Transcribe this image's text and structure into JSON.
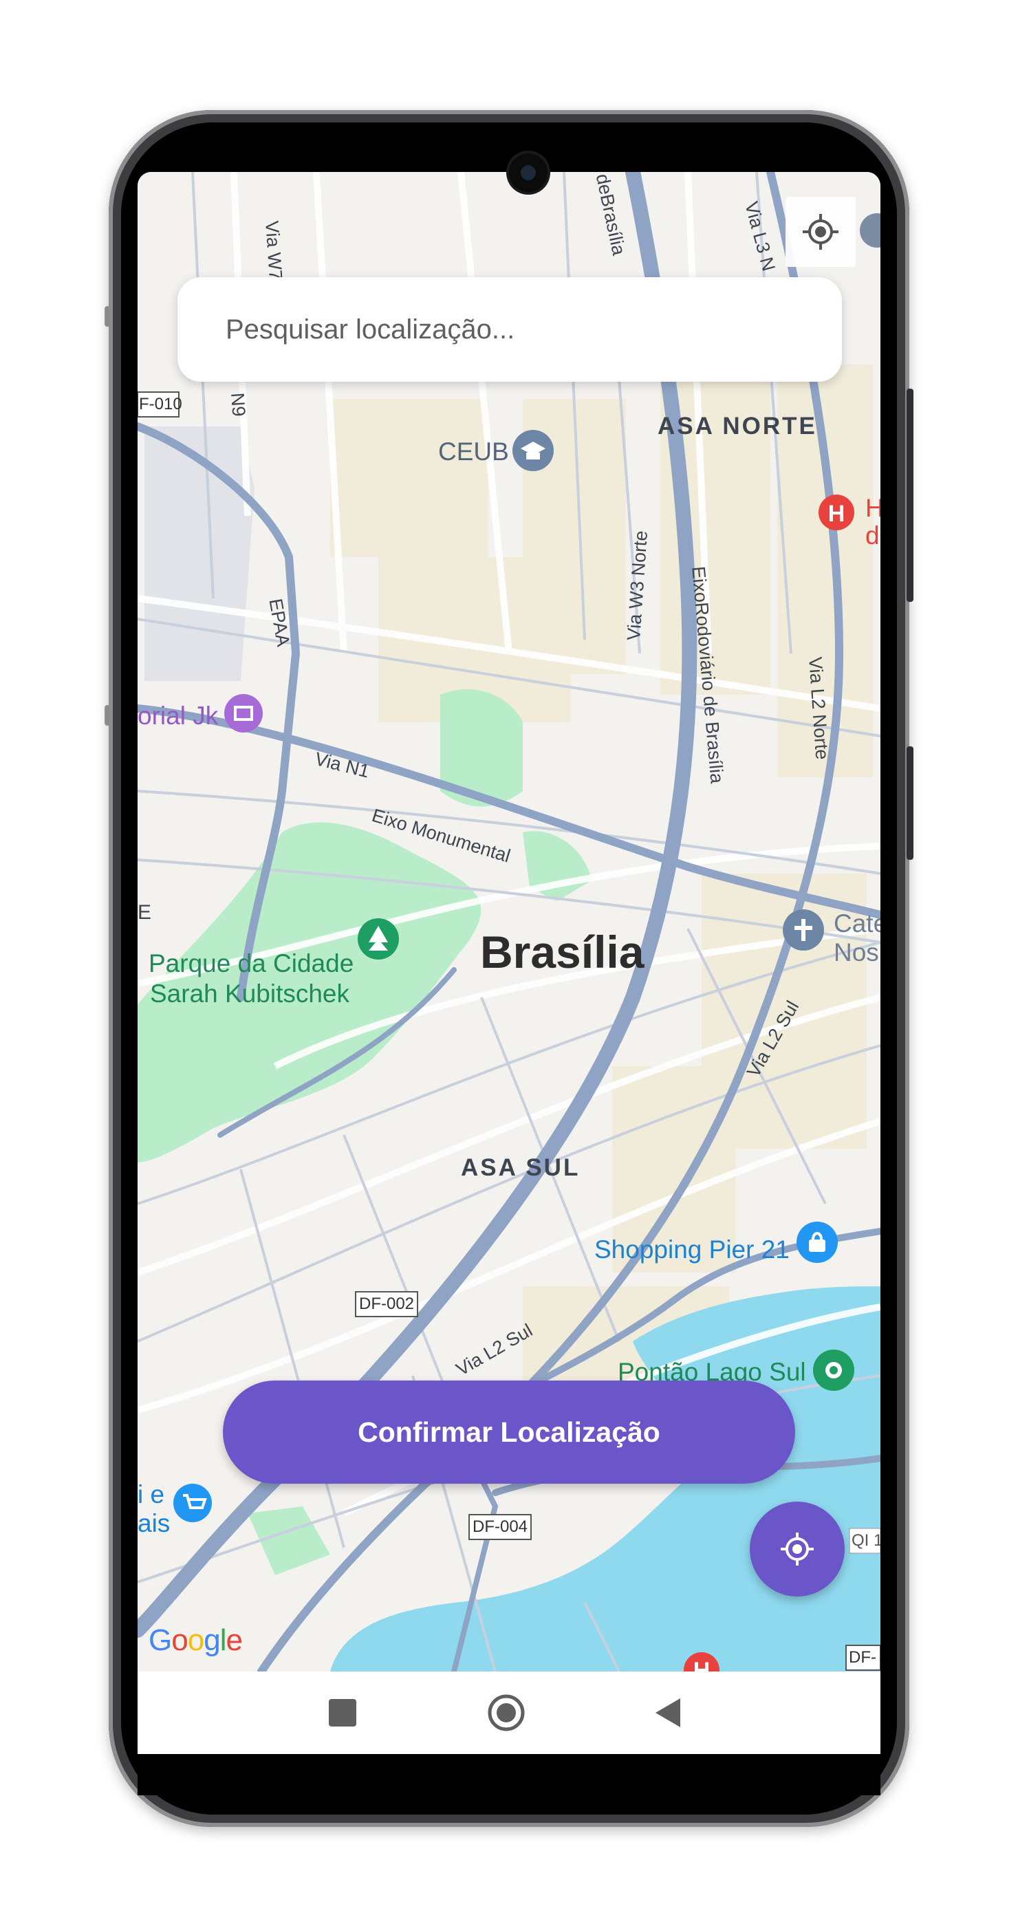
{
  "search": {
    "placeholder": "Pesquisar localização..."
  },
  "map": {
    "city_label": "Brasília",
    "districts": {
      "north": "ASA NORTE",
      "south": "ASA SUL"
    },
    "roads": {
      "w7": "Via W7",
      "n9": "N9",
      "epaa": "EPAA",
      "df010": "F-010",
      "n1": "Via N1",
      "eixo_monumental": "Eixo Monumental",
      "w3_norte": "Via W3 Norte",
      "eixo_rodoviario": "EixoRodoviário de Brasília",
      "eixo_top": "deBrasília",
      "l3": "Via L3 N",
      "l2_norte": "Via L2 Norte",
      "l2_sul_east": "Via L2 Sul",
      "l2_sul_south": "Via L2 Sul",
      "df002": "DF-002",
      "df004": "DF-004",
      "df_edge": "DF-",
      "qi": "QI 1",
      "e_edge": "E"
    },
    "places": {
      "ceub": "CEUB",
      "memorial_jk": "orial Jk",
      "hospital_1": "H",
      "hospital_2": "d",
      "parque_line1": "Parque da Cidade",
      "parque_line2": "Sarah Kubitschek",
      "catedral_1": "Cate",
      "catedral_2": "Nos",
      "shopping": "Shopping Pier 21",
      "pontao": "Pontão Lago Sul",
      "shop_left_1": "i e",
      "shop_left_2": "ais"
    },
    "attribution": "Google"
  },
  "buttons": {
    "confirm_label": "Confirmar Localização"
  },
  "icons": {
    "locate_map": "crosshair-icon",
    "locate_fab": "gps-target-icon",
    "nav_recent": "square-icon",
    "nav_home": "circle-icon",
    "nav_back": "triangle-back-icon"
  },
  "colors": {
    "accent": "#6a55c9",
    "park": "#b9ecc9",
    "water": "#8fd9ef",
    "road_major": "#8fa3c5",
    "hospital": "#e8423f",
    "poi_blue": "#2196f3",
    "poi_green": "#1e9e62",
    "poi_purple": "#a66bd6"
  }
}
